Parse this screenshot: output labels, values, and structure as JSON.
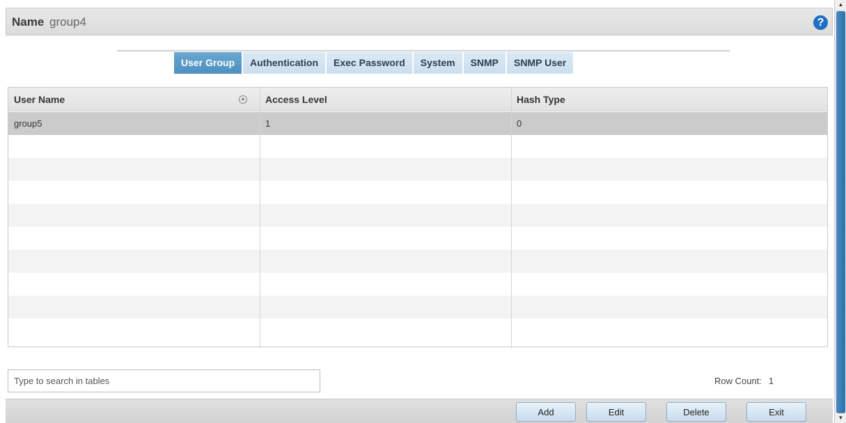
{
  "header": {
    "label": "Name",
    "value": "group4",
    "help": "?"
  },
  "tabs": [
    {
      "label": "User Group",
      "active": true
    },
    {
      "label": "Authentication",
      "active": false
    },
    {
      "label": "Exec Password",
      "active": false
    },
    {
      "label": "System",
      "active": false
    },
    {
      "label": "SNMP",
      "active": false
    },
    {
      "label": "SNMP User",
      "active": false
    }
  ],
  "table": {
    "columns": [
      "User Name",
      "Access Level",
      "Hash Type"
    ],
    "rows": [
      {
        "user_name": "group5",
        "access_level": "1",
        "hash_type": "0"
      }
    ]
  },
  "search": {
    "placeholder": "Type to search in tables"
  },
  "row_count": {
    "label": "Row Count:",
    "value": "1"
  },
  "buttons": {
    "add": "Add",
    "edit": "Edit",
    "delete": "Delete",
    "exit": "Exit"
  },
  "colors": {
    "accent": "#4d8fc0",
    "tab_bg": "#c9dfee",
    "selected_row": "#cbcbcb",
    "help_icon": "#1f6fc5"
  }
}
